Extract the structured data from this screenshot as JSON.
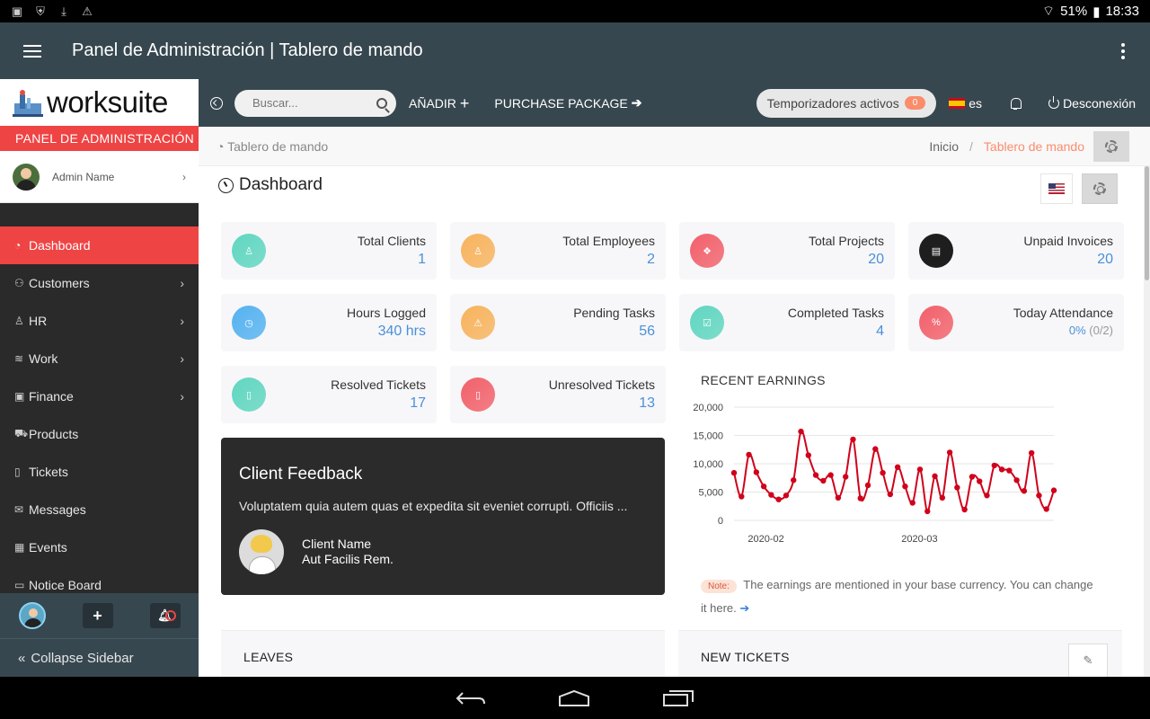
{
  "status_bar": {
    "battery": "51%",
    "time": "18:33"
  },
  "app_bar": {
    "title": "Panel de Administración | Tablero de mando"
  },
  "sidebar": {
    "logo_text": "worksuite",
    "panel_label": "PANEL DE ADMINISTRACIÓN",
    "admin_name": "Admin Name",
    "items": [
      {
        "label": "Dashboard",
        "icon": "dashboard-icon",
        "active": true,
        "has_arrow": false
      },
      {
        "label": "Customers",
        "icon": "users-icon",
        "active": false,
        "has_arrow": true
      },
      {
        "label": "HR",
        "icon": "user-icon",
        "active": false,
        "has_arrow": true
      },
      {
        "label": "Work",
        "icon": "layers-icon",
        "active": false,
        "has_arrow": true
      },
      {
        "label": "Finance",
        "icon": "money-icon",
        "active": false,
        "has_arrow": true
      },
      {
        "label": "Products",
        "icon": "cart-icon",
        "active": false,
        "has_arrow": false
      },
      {
        "label": "Tickets",
        "icon": "ticket-icon",
        "active": false,
        "has_arrow": false
      },
      {
        "label": "Messages",
        "icon": "envelope-icon",
        "active": false,
        "has_arrow": false
      },
      {
        "label": "Events",
        "icon": "calendar-icon",
        "active": false,
        "has_arrow": false
      },
      {
        "label": "Notice Board",
        "icon": "board-icon",
        "active": false,
        "has_arrow": false
      }
    ],
    "collapse_label": "Collapse Sidebar"
  },
  "topbar": {
    "search_placeholder": "Buscar...",
    "add_label": "AÑADIR",
    "purchase_label": "PURCHASE PACKAGE",
    "timers_label": "Temporizadores activos",
    "timers_count": "0",
    "language": "es",
    "logout_label": "Desconexión"
  },
  "breadcrumb": {
    "page_title": "Tablero de mando",
    "home": "Inicio",
    "separator": "/",
    "current": "Tablero de mando"
  },
  "dashboard": {
    "heading": "Dashboard",
    "stats": [
      {
        "label": "Total Clients",
        "value": "1",
        "color": "#5fd6c0"
      },
      {
        "label": "Total Employees",
        "value": "2",
        "color": "#f7b35c"
      },
      {
        "label": "Total Projects",
        "value": "20",
        "color": "#f2606a"
      },
      {
        "label": "Unpaid Invoices",
        "value": "20",
        "color": "#1e1e1e"
      },
      {
        "label": "Hours Logged",
        "value": "340 hrs",
        "color": "#54b2f0"
      },
      {
        "label": "Pending Tasks",
        "value": "56",
        "color": "#f7b35c"
      },
      {
        "label": "Completed Tasks",
        "value": "4",
        "color": "#5fd6c0"
      },
      {
        "label": "Today Attendance",
        "value": "0%",
        "sub": "(0/2)",
        "color": "#f2606a"
      },
      {
        "label": "Resolved Tickets",
        "value": "17",
        "color": "#5fd6c0"
      },
      {
        "label": "Unresolved Tickets",
        "value": "13",
        "color": "#f2606a"
      }
    ],
    "feedback": {
      "title": "Client Feedback",
      "text": "Voluptatem quia autem quas et expedita sit eveniet corrupti. Officiis ...",
      "client_name": "Client Name",
      "client_company": "Aut Facilis Rem."
    },
    "earnings": {
      "title": "RECENT EARNINGS",
      "note_tag": "Note:",
      "note_text": "The earnings are mentioned in your base currency. You can change it here."
    },
    "leaves_title": "LEAVES",
    "new_tickets_title": "NEW TICKETS"
  },
  "chart_data": {
    "type": "line",
    "title": "RECENT EARNINGS",
    "xlabel": "",
    "ylabel": "",
    "ylim": [
      0,
      20000
    ],
    "yticks": [
      "20,000",
      "15,000",
      "10,000",
      "5,000",
      "0"
    ],
    "xticks": [
      "2020-02",
      "2020-03"
    ],
    "x": [
      0,
      1,
      2,
      3,
      4,
      5,
      6,
      7,
      8,
      9,
      10,
      11,
      12,
      13,
      14,
      15,
      16,
      17,
      18,
      19,
      20,
      21,
      22,
      23,
      24,
      25,
      26,
      27,
      28,
      29,
      30,
      31,
      32,
      33,
      34,
      35,
      36,
      37,
      38,
      39,
      40,
      41,
      42,
      43
    ],
    "values": [
      8400,
      4200,
      11600,
      8500,
      6000,
      4500,
      3700,
      4400,
      7100,
      15700,
      11500,
      8000,
      7000,
      8000,
      4000,
      7700,
      14300,
      3900,
      6200,
      12600,
      8400,
      4600,
      9400,
      6000,
      3100,
      9000,
      1600,
      7800,
      4000,
      12000,
      5800,
      1900,
      7700,
      6900,
      4400,
      9700,
      9000,
      8800,
      7100,
      5200,
      11900,
      4400,
      2000,
      5300
    ],
    "series_color": "#d0021b",
    "grid": true
  }
}
